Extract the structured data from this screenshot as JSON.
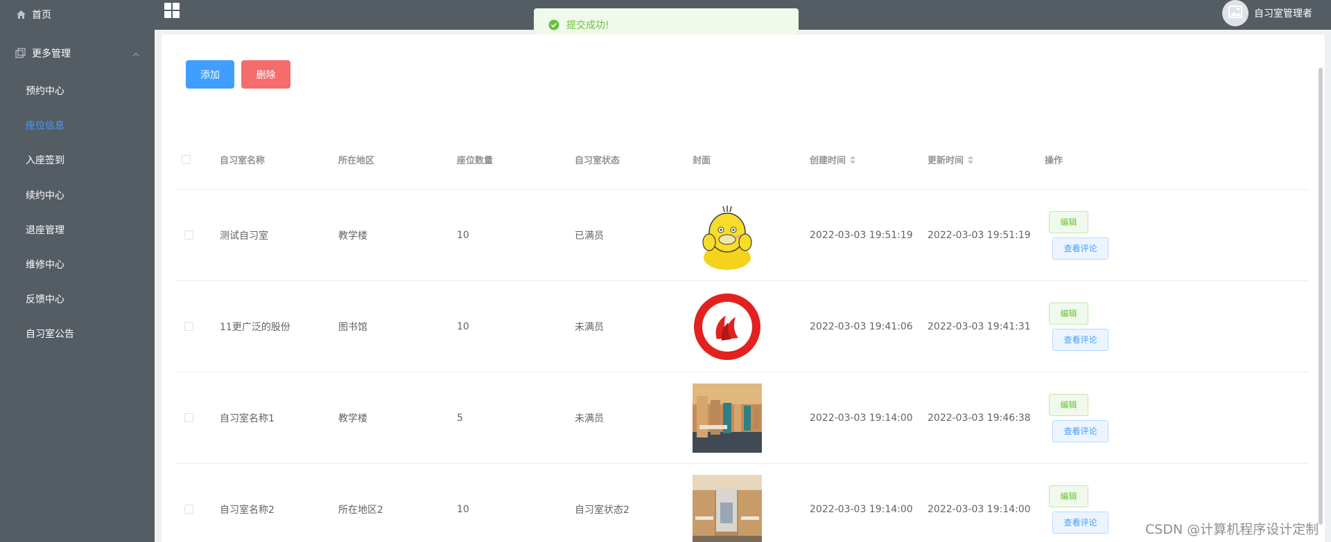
{
  "sidebar": {
    "home_label": "首页",
    "more_label": "更多管理",
    "items": [
      {
        "label": "预约中心",
        "active": false
      },
      {
        "label": "座位信息",
        "active": true
      },
      {
        "label": "入座签到",
        "active": false
      },
      {
        "label": "续约中心",
        "active": false
      },
      {
        "label": "退座管理",
        "active": false
      },
      {
        "label": "维修中心",
        "active": false
      },
      {
        "label": "反馈中心",
        "active": false
      },
      {
        "label": "自习室公告",
        "active": false
      }
    ]
  },
  "topbar": {
    "menu_icon": "grid-icon",
    "user_name": "自习室管理者",
    "avatar_icon": "image-icon"
  },
  "toast": {
    "message": "提交成功!",
    "icon": "check-circle-icon",
    "color": "#67c23a"
  },
  "toolbar": {
    "add_label": "添加",
    "delete_label": "删除"
  },
  "table": {
    "columns": [
      "自习室名称",
      "所在地区",
      "座位数量",
      "自习室状态",
      "封面",
      "创建时间",
      "更新时间",
      "操作"
    ],
    "rows": [
      {
        "name": "测试自习室",
        "area": "教学楼",
        "seats": "10",
        "status": "已满员",
        "cover": "duck-cover",
        "created": "2022-03-03 19:51:19",
        "updated": "2022-03-03 19:51:19"
      },
      {
        "name": "11更广泛的股份",
        "area": "图书馆",
        "seats": "10",
        "status": "未满员",
        "cover": "union-logo-cover",
        "created": "2022-03-03 19:41:06",
        "updated": "2022-03-03 19:41:31"
      },
      {
        "name": "自习室名称1",
        "area": "教学楼",
        "seats": "5",
        "status": "未满员",
        "cover": "study-room-photo-1",
        "created": "2022-03-03 19:14:00",
        "updated": "2022-03-03 19:46:38"
      },
      {
        "name": "自习室名称2",
        "area": "所在地区2",
        "seats": "10",
        "status": "自习室状态2",
        "cover": "study-room-photo-2",
        "created": "2022-03-03 19:14:00",
        "updated": "2022-03-03 19:14:00"
      }
    ],
    "edit_label": "编辑",
    "view_label": "查看评论"
  },
  "watermark": "CSDN @计算机程序设计定制",
  "colors": {
    "primary": "#409eff",
    "danger": "#f56c6c",
    "success": "#67c23a",
    "sidebar_bg": "#545c64"
  }
}
